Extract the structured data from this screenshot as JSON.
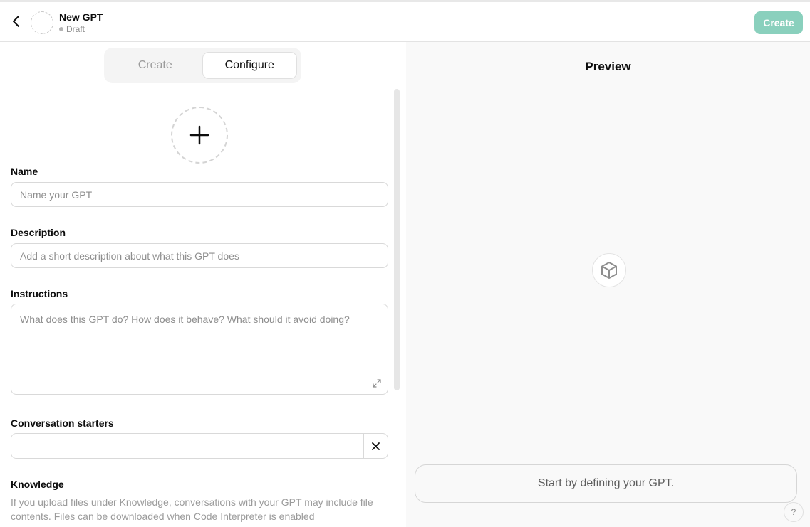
{
  "header": {
    "back_icon": "chevron-left-icon",
    "gpt_name": "New GPT",
    "gpt_status": "Draft",
    "create_label": "Create",
    "create_color": "#8ad0bd"
  },
  "tabs": [
    {
      "label": "Create",
      "active": false
    },
    {
      "label": "Configure",
      "active": true
    }
  ],
  "form": {
    "add_avatar_icon": "plus-icon",
    "name": {
      "label": "Name",
      "placeholder": "Name your GPT",
      "value": ""
    },
    "description": {
      "label": "Description",
      "placeholder": "Add a short description about what this GPT does",
      "value": ""
    },
    "instructions": {
      "label": "Instructions",
      "placeholder": "What does this GPT do? How does it behave? What should it avoid doing?",
      "value": "",
      "expand_icon": "expand-icon"
    },
    "conversation_starters": {
      "label": "Conversation starters",
      "value": "",
      "clear_icon": "close-icon"
    },
    "knowledge": {
      "label": "Knowledge",
      "description": "If you upload files under Knowledge, conversations with your GPT may include file contents. Files can be downloaded when Code Interpreter is enabled"
    }
  },
  "preview": {
    "title": "Preview",
    "center_icon": "cube-icon",
    "prompt_text": "Start by defining your GPT.",
    "help_label": "?"
  }
}
